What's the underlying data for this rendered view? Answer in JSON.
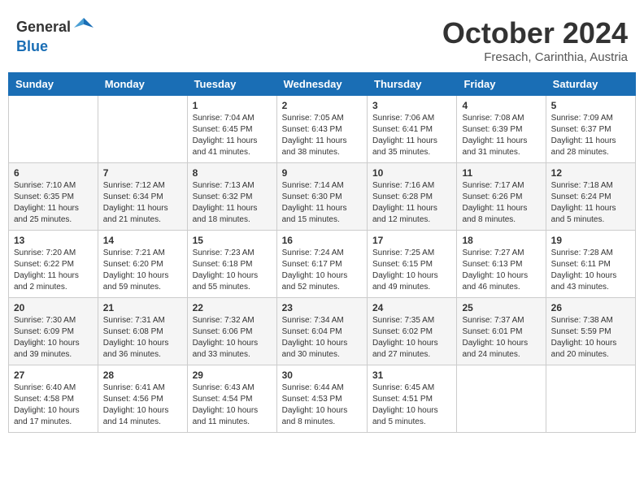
{
  "header": {
    "logo_general": "General",
    "logo_blue": "Blue",
    "month_title": "October 2024",
    "location": "Fresach, Carinthia, Austria"
  },
  "days_of_week": [
    "Sunday",
    "Monday",
    "Tuesday",
    "Wednesday",
    "Thursday",
    "Friday",
    "Saturday"
  ],
  "weeks": [
    [
      {
        "day": "",
        "info": ""
      },
      {
        "day": "",
        "info": ""
      },
      {
        "day": "1",
        "info": "Sunrise: 7:04 AM\nSunset: 6:45 PM\nDaylight: 11 hours and 41 minutes."
      },
      {
        "day": "2",
        "info": "Sunrise: 7:05 AM\nSunset: 6:43 PM\nDaylight: 11 hours and 38 minutes."
      },
      {
        "day": "3",
        "info": "Sunrise: 7:06 AM\nSunset: 6:41 PM\nDaylight: 11 hours and 35 minutes."
      },
      {
        "day": "4",
        "info": "Sunrise: 7:08 AM\nSunset: 6:39 PM\nDaylight: 11 hours and 31 minutes."
      },
      {
        "day": "5",
        "info": "Sunrise: 7:09 AM\nSunset: 6:37 PM\nDaylight: 11 hours and 28 minutes."
      }
    ],
    [
      {
        "day": "6",
        "info": "Sunrise: 7:10 AM\nSunset: 6:35 PM\nDaylight: 11 hours and 25 minutes."
      },
      {
        "day": "7",
        "info": "Sunrise: 7:12 AM\nSunset: 6:34 PM\nDaylight: 11 hours and 21 minutes."
      },
      {
        "day": "8",
        "info": "Sunrise: 7:13 AM\nSunset: 6:32 PM\nDaylight: 11 hours and 18 minutes."
      },
      {
        "day": "9",
        "info": "Sunrise: 7:14 AM\nSunset: 6:30 PM\nDaylight: 11 hours and 15 minutes."
      },
      {
        "day": "10",
        "info": "Sunrise: 7:16 AM\nSunset: 6:28 PM\nDaylight: 11 hours and 12 minutes."
      },
      {
        "day": "11",
        "info": "Sunrise: 7:17 AM\nSunset: 6:26 PM\nDaylight: 11 hours and 8 minutes."
      },
      {
        "day": "12",
        "info": "Sunrise: 7:18 AM\nSunset: 6:24 PM\nDaylight: 11 hours and 5 minutes."
      }
    ],
    [
      {
        "day": "13",
        "info": "Sunrise: 7:20 AM\nSunset: 6:22 PM\nDaylight: 11 hours and 2 minutes."
      },
      {
        "day": "14",
        "info": "Sunrise: 7:21 AM\nSunset: 6:20 PM\nDaylight: 10 hours and 59 minutes."
      },
      {
        "day": "15",
        "info": "Sunrise: 7:23 AM\nSunset: 6:18 PM\nDaylight: 10 hours and 55 minutes."
      },
      {
        "day": "16",
        "info": "Sunrise: 7:24 AM\nSunset: 6:17 PM\nDaylight: 10 hours and 52 minutes."
      },
      {
        "day": "17",
        "info": "Sunrise: 7:25 AM\nSunset: 6:15 PM\nDaylight: 10 hours and 49 minutes."
      },
      {
        "day": "18",
        "info": "Sunrise: 7:27 AM\nSunset: 6:13 PM\nDaylight: 10 hours and 46 minutes."
      },
      {
        "day": "19",
        "info": "Sunrise: 7:28 AM\nSunset: 6:11 PM\nDaylight: 10 hours and 43 minutes."
      }
    ],
    [
      {
        "day": "20",
        "info": "Sunrise: 7:30 AM\nSunset: 6:09 PM\nDaylight: 10 hours and 39 minutes."
      },
      {
        "day": "21",
        "info": "Sunrise: 7:31 AM\nSunset: 6:08 PM\nDaylight: 10 hours and 36 minutes."
      },
      {
        "day": "22",
        "info": "Sunrise: 7:32 AM\nSunset: 6:06 PM\nDaylight: 10 hours and 33 minutes."
      },
      {
        "day": "23",
        "info": "Sunrise: 7:34 AM\nSunset: 6:04 PM\nDaylight: 10 hours and 30 minutes."
      },
      {
        "day": "24",
        "info": "Sunrise: 7:35 AM\nSunset: 6:02 PM\nDaylight: 10 hours and 27 minutes."
      },
      {
        "day": "25",
        "info": "Sunrise: 7:37 AM\nSunset: 6:01 PM\nDaylight: 10 hours and 24 minutes."
      },
      {
        "day": "26",
        "info": "Sunrise: 7:38 AM\nSunset: 5:59 PM\nDaylight: 10 hours and 20 minutes."
      }
    ],
    [
      {
        "day": "27",
        "info": "Sunrise: 6:40 AM\nSunset: 4:58 PM\nDaylight: 10 hours and 17 minutes."
      },
      {
        "day": "28",
        "info": "Sunrise: 6:41 AM\nSunset: 4:56 PM\nDaylight: 10 hours and 14 minutes."
      },
      {
        "day": "29",
        "info": "Sunrise: 6:43 AM\nSunset: 4:54 PM\nDaylight: 10 hours and 11 minutes."
      },
      {
        "day": "30",
        "info": "Sunrise: 6:44 AM\nSunset: 4:53 PM\nDaylight: 10 hours and 8 minutes."
      },
      {
        "day": "31",
        "info": "Sunrise: 6:45 AM\nSunset: 4:51 PM\nDaylight: 10 hours and 5 minutes."
      },
      {
        "day": "",
        "info": ""
      },
      {
        "day": "",
        "info": ""
      }
    ]
  ]
}
